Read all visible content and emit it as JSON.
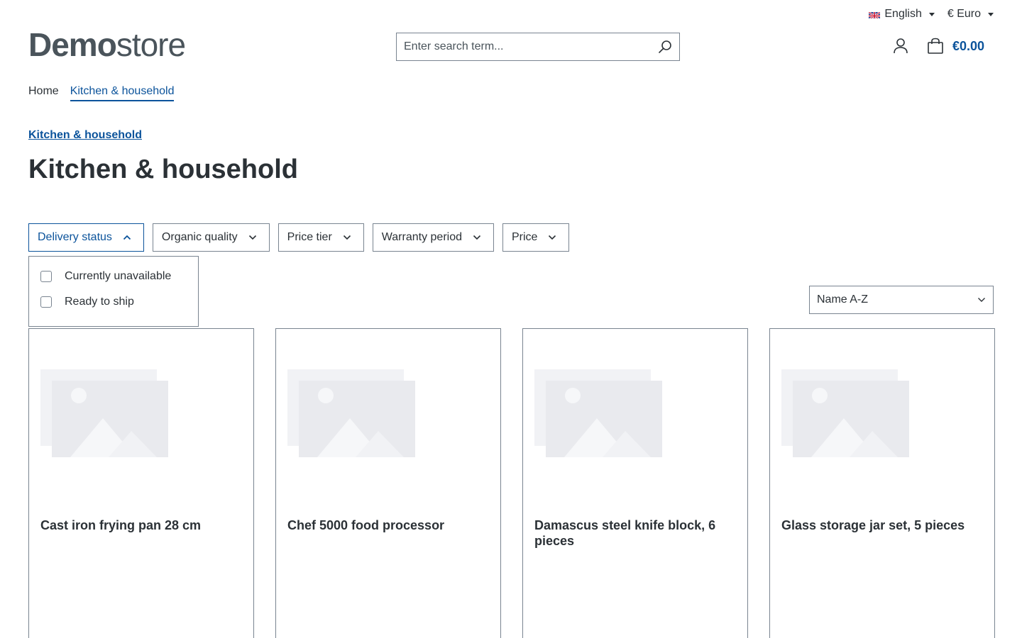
{
  "topbar": {
    "language": "English",
    "currency": "€ Euro"
  },
  "logo": {
    "bold": "Demo",
    "light": "store"
  },
  "search": {
    "placeholder": "Enter search term..."
  },
  "cart": {
    "total": "€0.00"
  },
  "nav": {
    "home": "Home",
    "active": "Kitchen & household"
  },
  "breadcrumb": "Kitchen & household",
  "page_title": "Kitchen & household",
  "filters": [
    {
      "label": "Delivery status",
      "open": true
    },
    {
      "label": "Organic quality"
    },
    {
      "label": "Price tier"
    },
    {
      "label": "Warranty period"
    },
    {
      "label": "Price"
    }
  ],
  "delivery_options": [
    "Currently unavailable",
    "Ready to ship"
  ],
  "sort": {
    "selected": "Name A-Z"
  },
  "products": [
    {
      "name": "Cast iron frying pan 28 cm"
    },
    {
      "name": "Chef 5000 food processor"
    },
    {
      "name": "Damascus steel knife block, 6 pieces"
    },
    {
      "name": "Glass storage jar set, 5 pieces"
    }
  ],
  "colors": {
    "accent": "#0b539b",
    "text": "#2b3136",
    "border": "#798490",
    "placeholder_image": "#e9eaee"
  }
}
